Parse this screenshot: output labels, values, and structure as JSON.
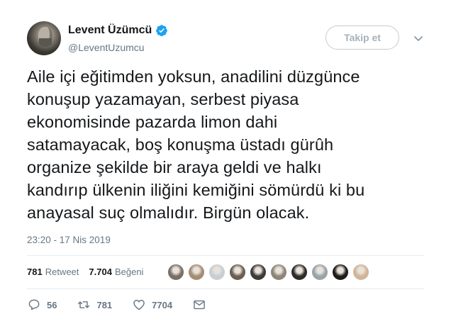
{
  "author": {
    "name": "Levent Üzümcü",
    "handle": "@LeventUzumcu",
    "verified": true
  },
  "follow_label": "Takip et",
  "tweet_text": "Aile içi eğitimden yoksun, anadilini düzgünce\nkonuşup yazamayan, serbest piyasa\nekonomisinde pazarda limon dahi\nsatamayacak, boş konuşma üstadı gürûh\norganize şekilde bir araya geldi ve halkı\nkandırıp ülkenin iliğini kemiğini sömürdü ki bu\nanayasal suç olmalıdır. Birgün olacak.",
  "timestamp": "23:20 - 17 Nis 2019",
  "stats": {
    "retweets": "781",
    "retweets_label": "Retweet",
    "likes": "7.704",
    "likes_label": "Beğeni"
  },
  "likers": [
    "#7a6f66",
    "#a58c74",
    "#c9ced3",
    "#6b5e52",
    "#3d3a38",
    "#8f8478",
    "#2e2b28",
    "#9aa3a8",
    "#1f1c1a",
    "#d2b49a"
  ],
  "actions": {
    "reply_count": "56",
    "retweet_count": "781",
    "like_count": "7704"
  },
  "colors": {
    "verified": "#1da1f2",
    "secondary_text": "#657786"
  }
}
